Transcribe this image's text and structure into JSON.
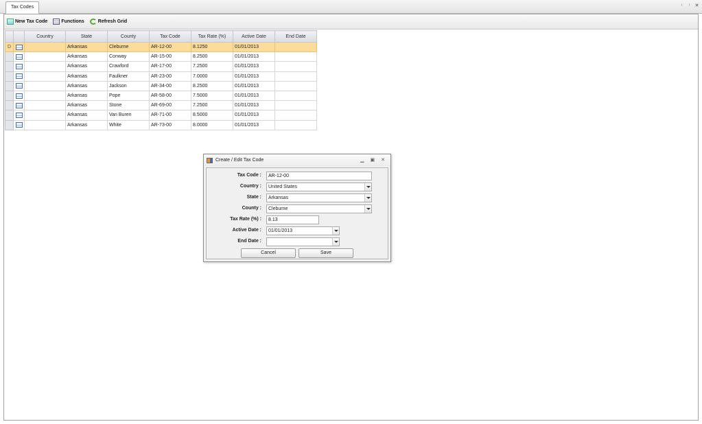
{
  "tab": {
    "label": "Tax Codes"
  },
  "toolbar": {
    "new_label": "New Tax Code",
    "functions_label": "Functions",
    "refresh_label": "Refresh Grid"
  },
  "grid": {
    "columns": [
      "Country",
      "State",
      "County",
      "Tax Code",
      "Tax Rate (%)",
      "Active Date",
      "End Date"
    ],
    "current_row_marker": "D",
    "rows": [
      [
        "",
        "Arkansas",
        "Cleburne",
        "AR-12-00",
        "8.1250",
        "01/01/2013",
        ""
      ],
      [
        "",
        "Arkansas",
        "Conway",
        "AR-15-00",
        "8.2500",
        "01/01/2013",
        ""
      ],
      [
        "",
        "Arkansas",
        "Crawford",
        "AR-17-00",
        "7.2500",
        "01/01/2013",
        ""
      ],
      [
        "",
        "Arkansas",
        "Faulkner",
        "AR-23-00",
        "7.0000",
        "01/01/2013",
        ""
      ],
      [
        "",
        "Arkansas",
        "Jackson",
        "AR-34-00",
        "8.2500",
        "01/01/2013",
        ""
      ],
      [
        "",
        "Arkansas",
        "Pope",
        "AR-58-00",
        "7.5000",
        "01/01/2013",
        ""
      ],
      [
        "",
        "Arkansas",
        "Stone",
        "AR-69-00",
        "7.2500",
        "01/01/2013",
        ""
      ],
      [
        "",
        "Arkansas",
        "Van Buren",
        "AR-71-00",
        "8.5000",
        "01/01/2013",
        ""
      ],
      [
        "",
        "Arkansas",
        "White",
        "AR-73-00",
        "8.0000",
        "01/01/2013",
        ""
      ]
    ]
  },
  "dialog": {
    "title": "Create / Edit Tax Code",
    "fields": {
      "tax_code": {
        "label": "Tax Code :",
        "value": "AR-12-00"
      },
      "country": {
        "label": "Country :",
        "value": "United States"
      },
      "state": {
        "label": "State :",
        "value": "Arkansas"
      },
      "county": {
        "label": "County :",
        "value": "Cleburne"
      },
      "tax_rate": {
        "label": "Tax Rate (%) :",
        "value": "8.13"
      },
      "active_date": {
        "label": "Active Date :",
        "value": "01/01/2013"
      },
      "end_date": {
        "label": "End Date :",
        "value": ""
      }
    },
    "cancel_label": "Cancel",
    "save_label": "Save"
  }
}
